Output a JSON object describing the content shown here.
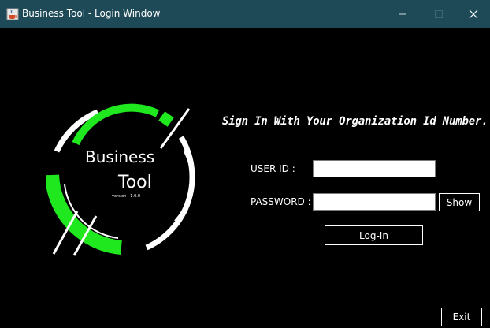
{
  "window": {
    "title": "Business Tool - Login Window",
    "minimize_glyph": "—",
    "maximize_glyph": "☐",
    "close_glyph": "✕"
  },
  "logo": {
    "line1": "Business",
    "line2": "Tool",
    "version": "version - 1.0.0",
    "accent_color": "#1fe81f"
  },
  "login": {
    "heading": "Sign In With Your Organization Id Number.",
    "userid_label": "USER ID :",
    "userid_value": "",
    "password_label": "PASSWORD :",
    "password_value": "",
    "show_label": "Show",
    "login_label": "Log-In"
  },
  "footer": {
    "exit_label": "Exit"
  },
  "colors": {
    "background": "#000000",
    "titlebar": "#1e4a58",
    "text": "#ffffff"
  }
}
